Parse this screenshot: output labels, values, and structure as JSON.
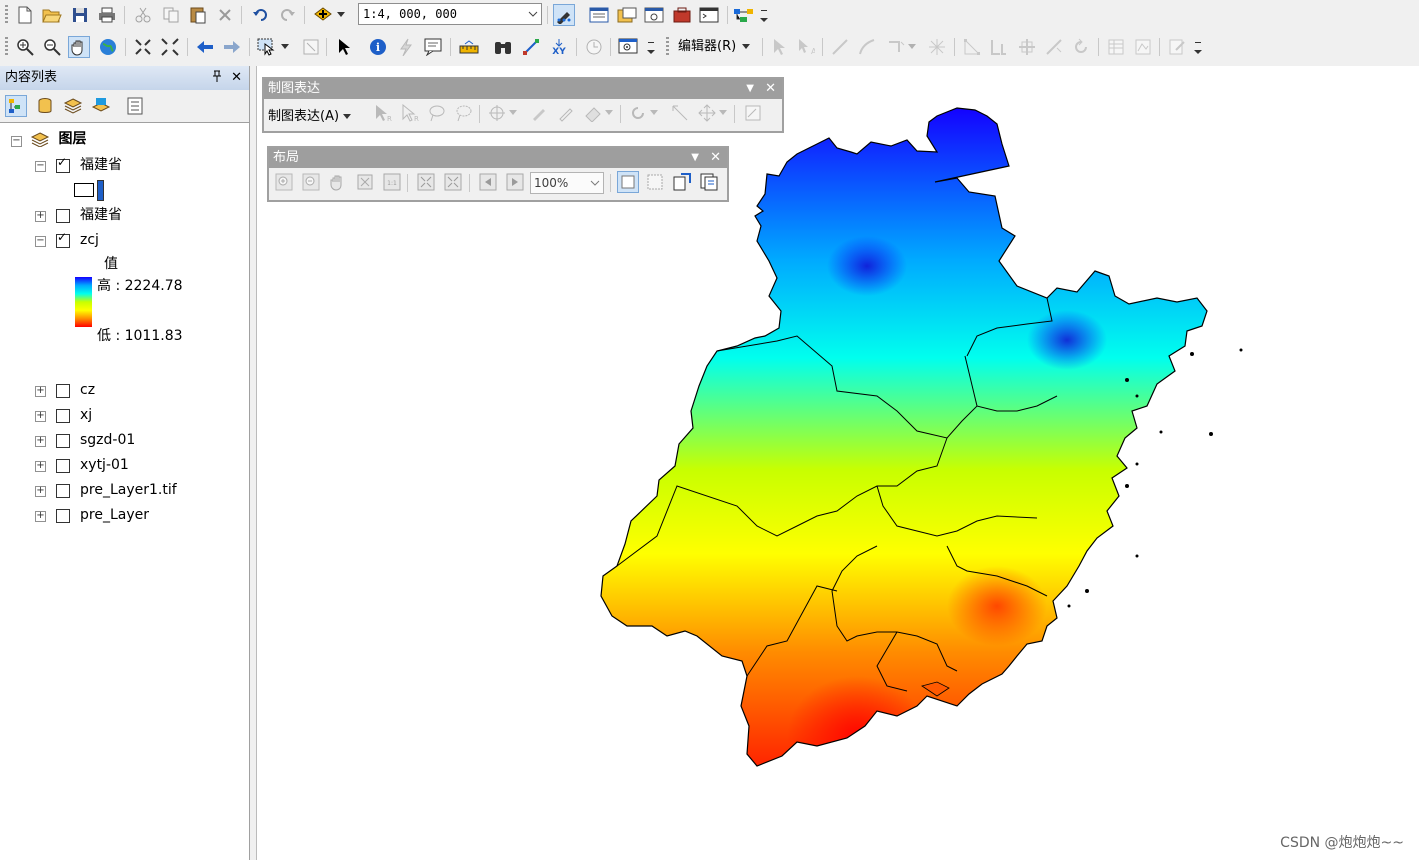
{
  "toolbar1": {
    "scale_value": "1:4, 000, 000"
  },
  "toolbar2": {
    "editor_menu": "编辑器(R)"
  },
  "toc": {
    "title": "内容列表",
    "root_label": "图层",
    "layers": [
      {
        "label": "福建省",
        "checked": true,
        "expanded": true
      },
      {
        "label": "福建省",
        "checked": false,
        "expanded": false
      },
      {
        "label": "zcj",
        "checked": true,
        "expanded": true
      },
      {
        "label": "cz",
        "checked": false,
        "expanded": false
      },
      {
        "label": "xj",
        "checked": false,
        "expanded": false
      },
      {
        "label": "sgzd-01",
        "checked": false,
        "expanded": false
      },
      {
        "label": "xytj-01",
        "checked": false,
        "expanded": false
      },
      {
        "label": "pre_Layer1.tif",
        "checked": false,
        "expanded": false
      },
      {
        "label": "pre_Layer",
        "checked": false,
        "expanded": false
      }
    ],
    "legend": {
      "value_heading": "值",
      "high_label": "高 : 2224.78",
      "low_label": "低 : 1011.83",
      "colors": [
        "#1400ff",
        "#00aaff",
        "#00ffee",
        "#c8ff00",
        "#ffff00",
        "#ff8c00",
        "#ff0000"
      ]
    }
  },
  "cartography_toolbar": {
    "title": "制图表达",
    "menu": "制图表达(A)"
  },
  "layout_toolbar": {
    "title": "布局",
    "zoom_value": "100%"
  },
  "watermark": "CSDN @炮炮炮~~"
}
